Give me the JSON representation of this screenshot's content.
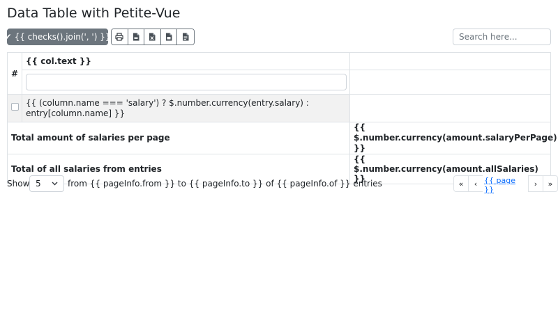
{
  "title": "Data Table with Petite-Vue",
  "toolbar": {
    "checks_label": "{{ checks().join(', ') }}",
    "checks_icon": "check-icon",
    "export_buttons": [
      {
        "name": "print-button",
        "icon": "printer-icon"
      },
      {
        "name": "export-csv-button",
        "icon": "file-icon"
      },
      {
        "name": "export-excel-button",
        "icon": "file-excel-icon"
      },
      {
        "name": "export-pdf-button",
        "icon": "file-icon"
      },
      {
        "name": "export-text-button",
        "icon": "file-text-icon"
      }
    ]
  },
  "search": {
    "placeholder": "Search here..."
  },
  "table": {
    "hash_header": "#",
    "column_header": "{{ col.text }}",
    "cell_template": "{{ (column.name === 'salary') ? $.number.currency(entry.salary) : entry[column.name] }}",
    "totals": [
      {
        "label": "Total amount of salaries per page",
        "value": "{{ $.number.currency(amount.salaryPerPage) }}"
      },
      {
        "label": "Total of all salaries from entries",
        "value": "{{ $.number.currency(amount.allSalaries) }}"
      }
    ]
  },
  "footer": {
    "show_label": "Show",
    "page_size": "5",
    "entries_info": "from {{ pageInfo.from }} to {{ pageInfo.to }} of {{ pageInfo.of }} entries"
  },
  "pagination": {
    "first": "«",
    "prev": "‹",
    "current": "{{ page }}",
    "next": "›",
    "last": "»"
  },
  "colors": {
    "secondary": "#6c757d",
    "border": "#dee2e6",
    "link": "#0d6efd",
    "row_bg": "#f2f2f2"
  }
}
